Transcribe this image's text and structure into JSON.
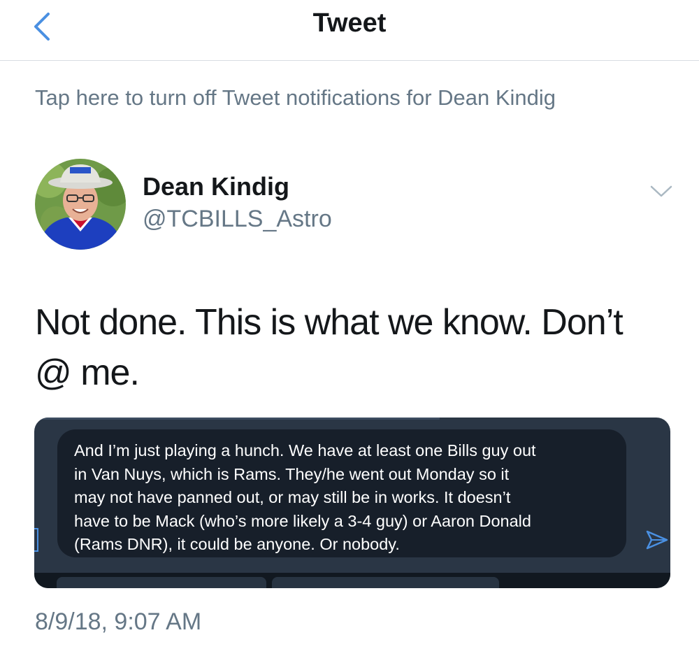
{
  "nav": {
    "title": "Tweet",
    "back_icon": "chevron-left-icon"
  },
  "notification_bar": {
    "text": "Tap here to turn off Tweet notifications for Dean Kindig"
  },
  "author": {
    "display_name": "Dean Kindig",
    "handle": "@TCBILLS_Astro"
  },
  "tweet": {
    "text": "Not done. This is what we know. Don’t @ me.",
    "timestamp": "8/9/18, 9:07 AM"
  },
  "media": {
    "message_text": "And I’m just playing a hunch. We have at least one Bills guy out\nin Van Nuys, which is Rams. They/he went out Monday so it\nmay not have panned out, or may still be in works. It doesn’t\nhave to be Mack (who’s more likely a 3-4 guy) or Aaron Donald\n(Rams DNR), it could be anyone. Or nobody.",
    "send_icon": "send-icon"
  },
  "colors": {
    "accent": "#4a90e2",
    "secondary_text": "#657786",
    "primary_text": "#14171a",
    "media_bg": "#2a3645",
    "bubble_bg": "#171f2a"
  }
}
